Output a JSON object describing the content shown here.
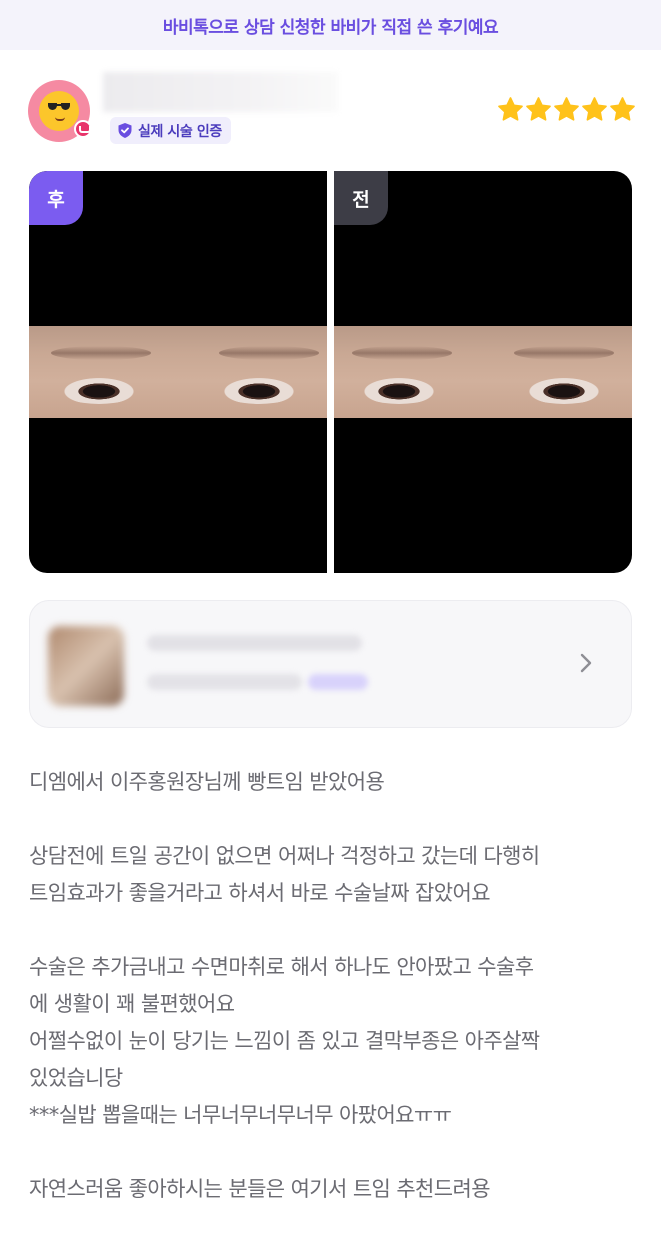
{
  "banner": {
    "text": "바비톡으로 상담 신청한 바비가 직접 쓴 후기예요"
  },
  "user": {
    "avatar_icon": "sunglasses-emoji-icon",
    "verified_label": "실제 시술 인증",
    "rating": 5,
    "rating_max": 5
  },
  "photos": {
    "after_label": "후",
    "before_label": "전"
  },
  "colors": {
    "brand": "#6a4ee0",
    "after_tag": "#7b5cf0",
    "before_tag": "#3d3d46",
    "star": "#ffc21a"
  },
  "review": {
    "paragraphs": [
      "디엠에서 이주홍원장님께 빵트임 받았어용",
      "상담전에 트일 공간이 없으면 어쩌나 걱정하고 갔는데 다행히\n트임효과가 좋을거라고 하셔서 바로 수술날짜 잡았어요",
      "수술은 추가금내고 수면마취로 해서 하나도 안아팠고 수술후\n에 생활이 꽤 불편했어요\n어쩔수없이 눈이 당기는 느낌이 좀 있고 결막부종은 아주살짝\n있었습니당\n***실밥 뽑을때는 너무너무너무너무 아팠어요ㅠㅠ",
      "자연스러움 좋아하시는 분들은 여기서 트임 추천드려용"
    ]
  }
}
